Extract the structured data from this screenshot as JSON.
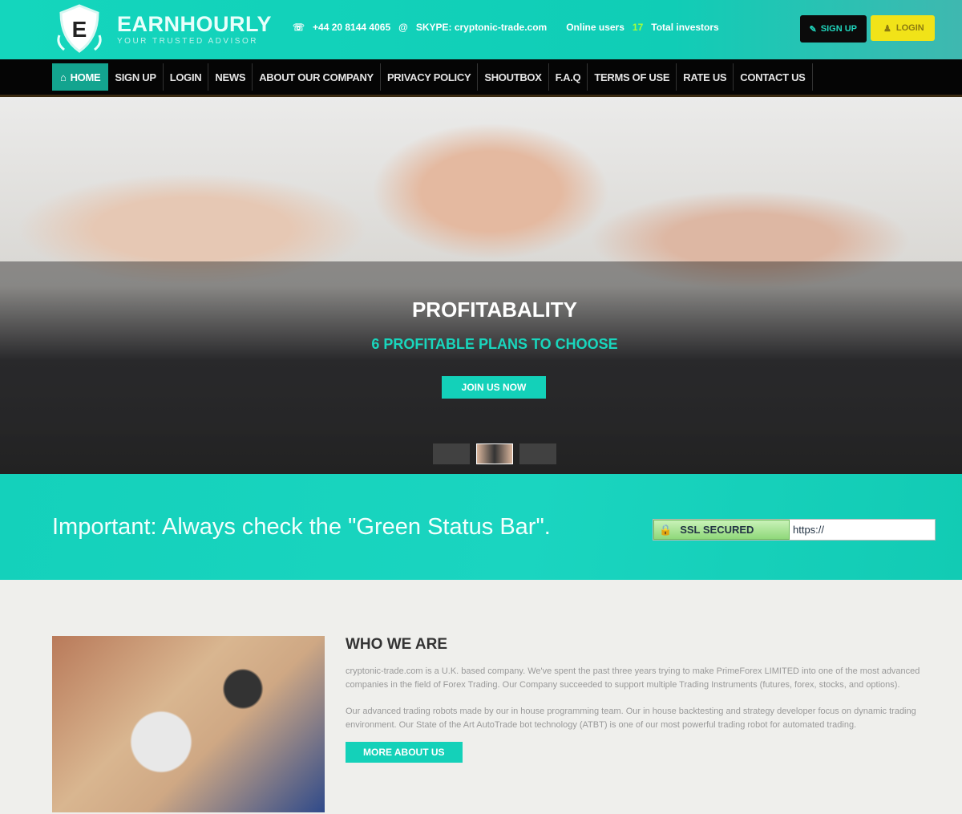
{
  "header": {
    "brand": "EARNHOURLY",
    "tagline": "YOUR TRUSTED ADVISOR",
    "logo_letter": "E",
    "phone": "+44 20 8144 4065",
    "skype": "SKYPE: cryptonic-trade.com",
    "online_users": "Online users",
    "online_count": "17",
    "total_investors": "Total investors",
    "signup": "SIGN UP",
    "login": "LOGIN"
  },
  "nav": [
    "HOME",
    "SIGN UP",
    "LOGIN",
    "NEWS",
    "ABOUT OUR COMPANY",
    "PRIVACY POLICY",
    "SHOUTBOX",
    "F.A.Q",
    "TERMS OF USE",
    "RATE US",
    "CONTACT US"
  ],
  "hero": {
    "title": "PROFITABALITY",
    "subtitle": "6 PROFITABLE PLANS TO CHOOSE",
    "cta": "JOIN US NOW",
    "active_slide": 2
  },
  "notice": {
    "text": "Important: Always check the \"Green Status Bar\".",
    "ssl": "SSL SECURED",
    "url": "https://"
  },
  "about": {
    "title": "WHO WE ARE",
    "p1": "cryptonic-trade.com is a U.K. based company. We've spent the past three years trying to make PrimeForex LIMITED into one of the most advanced companies in the field of Forex Trading. Our Company succeeded to support multiple Trading Instruments (futures, forex, stocks, and options).",
    "p2": "Our advanced trading robots made by our in house programming team. Our in house backtesting and strategy developer focus on dynamic trading environment. Our State of the Art AutoTrade bot technology (ATBT) is one of our most powerful trading robot for automated trading.",
    "more": "MORE ABOUT US"
  },
  "colors": {
    "accent": "#14d1b9",
    "nav_bg": "#050505",
    "login_btn": "#f1e318"
  }
}
